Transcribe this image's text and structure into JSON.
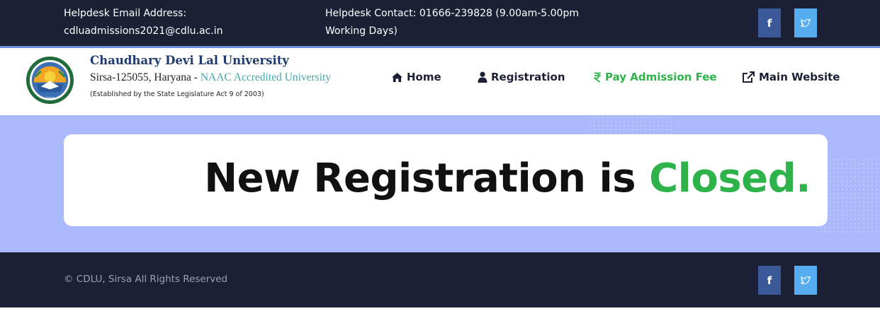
{
  "topbar": {
    "email_label": "Helpdesk Email Address:",
    "email_value": "cdluadmissions2021@cdlu.ac.in",
    "contact_line1": "Helpdesk Contact: 01666-239828 (9.00am-5.00pm",
    "contact_line2": "Working Days)",
    "facebook_glyph": "f",
    "facebook_icon": "facebook-icon",
    "twitter_icon": "twitter-icon"
  },
  "header": {
    "university_name": "Chaudhary Devi Lal University",
    "location": "Sirsa-125055, Haryana - ",
    "naac": "NAAC Accredited University",
    "established": "(Established by the State Legislature Act 9 of 2003)",
    "logo_icon": "university-seal-logo"
  },
  "nav": {
    "home": "Home",
    "registration": "Registration",
    "pay_fee": "Pay Admission Fee",
    "main_website": "Main Website"
  },
  "notice": {
    "prefix": "New Registration is ",
    "status": "Closed."
  },
  "footer": {
    "copyright": "© CDLU, Sirsa All Rights Reserved",
    "facebook_glyph": "f"
  },
  "colors": {
    "dark": "#1b2035",
    "accent_green": "#2db34a",
    "hero_background": "#a9b9fb",
    "facebook": "#3b5998",
    "twitter": "#55acee"
  }
}
